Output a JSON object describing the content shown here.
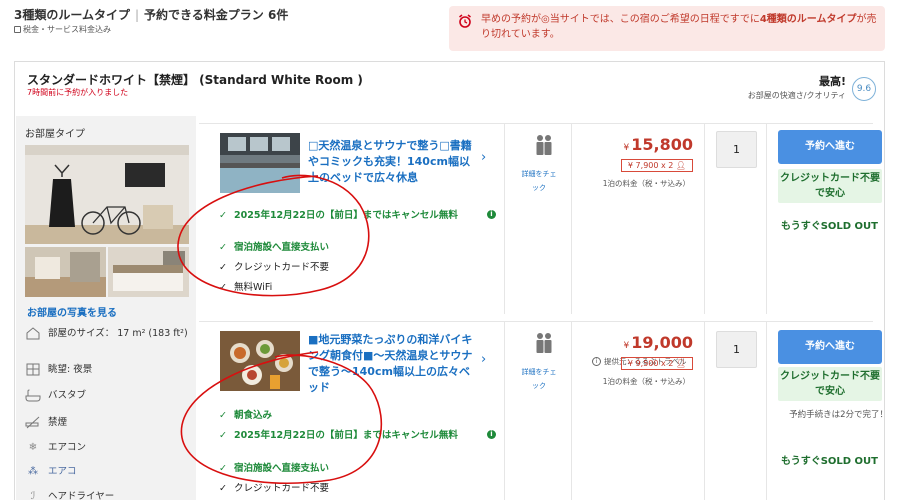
{
  "header": {
    "title_left": "3種類のルームタイプ",
    "title_right": "予約できる料金プラン 6件",
    "tax_note": "税金・サービス料金込み"
  },
  "alert": {
    "text_pre": "早めの予約が◎当サイトでは、この宿のご希望の日程ですでに",
    "text_bold": "4種類のルームタイプ",
    "text_post": "が売り切れています。"
  },
  "room": {
    "title": "スタンダードホワイト【禁煙】 (Standard White Room )",
    "booked_note": "7時間前に予約が入りました",
    "rating_label": "最高!",
    "rating_sub": "お部屋の快適さ/クオリティ",
    "rating_score": "9.6",
    "room_type_label": "お部屋タイプ",
    "photo_link": "お部屋の写真を見る",
    "amenities": [
      {
        "icon": "room-size-icon",
        "label": "部屋のサイズ： 17 m² (183 ft²)"
      },
      {
        "icon": "view-icon",
        "label": "眺望: 夜景"
      },
      {
        "icon": "bathtub-icon",
        "label": "バスタブ"
      },
      {
        "icon": "no-smoking-icon",
        "label": "禁煙"
      },
      {
        "icon": "aircon-icon",
        "label": "エアコン"
      },
      {
        "icon": "aircon-icon",
        "label": "エアコ"
      },
      {
        "icon": "hairdryer-icon",
        "label": "ヘアドライヤー"
      }
    ]
  },
  "plans": [
    {
      "name": "□天然温泉とサウナで整う□書籍やコミックも充実！140cm幅以上のベッドで広々休息",
      "conditions": [
        {
          "text": "2025年12月22日の【前日】まではキャンセル無料",
          "style": "green"
        },
        {
          "text": "宿泊施設へ直接支払い",
          "style": "green"
        },
        {
          "text": "クレジットカード不要",
          "style": "dark"
        },
        {
          "text": "無料WiFi",
          "style": "dark"
        }
      ],
      "detail_label": "詳細をチェック",
      "currency": "¥",
      "price": "15,800",
      "price_breakdown": "¥ 7,900 x 2",
      "price_note": "1泊の料金（税・サ込み）",
      "provider": "提供元：るるぶトラベル",
      "quantity": "1",
      "book_label": "予約へ進む",
      "nocard_label": "クレジットカード不要で安心",
      "booking_time": "",
      "soldout": "もうすぐSOLD OUT"
    },
    {
      "name": "■地元野菜たっぷりの和洋バイキング朝食付■～天然温泉とサウナで整う～140cm幅以上の広々ベッド",
      "conditions": [
        {
          "text": "朝食込み",
          "style": "green"
        },
        {
          "text": "2025年12月22日の【前日】まではキャンセル無料",
          "style": "green"
        },
        {
          "text": "宿泊施設へ直接支払い",
          "style": "green"
        },
        {
          "text": "クレジットカード不要",
          "style": "dark"
        }
      ],
      "detail_label": "詳細をチェック",
      "currency": "¥",
      "price": "19,000",
      "price_breakdown": "¥ 9,500 x 2",
      "price_note": "1泊の料金（税・サ込み）",
      "quantity": "1",
      "book_label": "予約へ進む",
      "nocard_label": "クレジットカード不要で安心",
      "booking_time": "予約手続きは2分で完了！",
      "soldout": "もうすぐSOLD OUT"
    }
  ],
  "colors": {
    "accent_blue": "#4a90e2",
    "price_red": "#c0392b",
    "green": "#1e8a3a",
    "alert_bg": "#fbe8e6"
  }
}
